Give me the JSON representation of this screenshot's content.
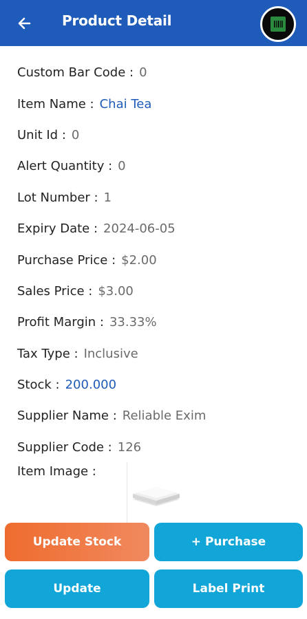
{
  "header": {
    "title": "Product Detail",
    "back_icon": "arrow-left-icon",
    "scan_icon": "barcode-scan-icon",
    "color": "#1f5bb8"
  },
  "details": [
    {
      "label": "Custom Bar Code :",
      "value": "0"
    },
    {
      "label": "Item Name :",
      "value": "Chai Tea"
    },
    {
      "label": "Unit Id :",
      "value": "0"
    },
    {
      "label": "Alert Quantity :",
      "value": "0"
    },
    {
      "label": "Lot Number :",
      "value": "1"
    },
    {
      "label": "Expiry Date :",
      "value": "2024-06-05"
    },
    {
      "label": "Purchase Price :",
      "value": "$2.00"
    },
    {
      "label": "Sales Price :",
      "value": "$3.00"
    },
    {
      "label": "Profit Margin :",
      "value": "33.33%"
    },
    {
      "label": "Tax Type :",
      "value": "Inclusive"
    },
    {
      "label": "Stock :",
      "value": "200.000"
    },
    {
      "label": "Supplier Name :",
      "value": "Reliable Exim"
    },
    {
      "label": "Supplier Code :",
      "value": "126"
    }
  ],
  "item_image": {
    "label": "Item Image :",
    "icon": "product-thumbnail"
  },
  "buttons": {
    "update_stock": "Update Stock",
    "purchase": "+ Purchase",
    "update": "Update",
    "label_print": "Label Print"
  },
  "colors": {
    "accent_orange": "#ef6c2e",
    "accent_cyan": "#12a6d8",
    "value_blue": "#1f5bb8"
  }
}
